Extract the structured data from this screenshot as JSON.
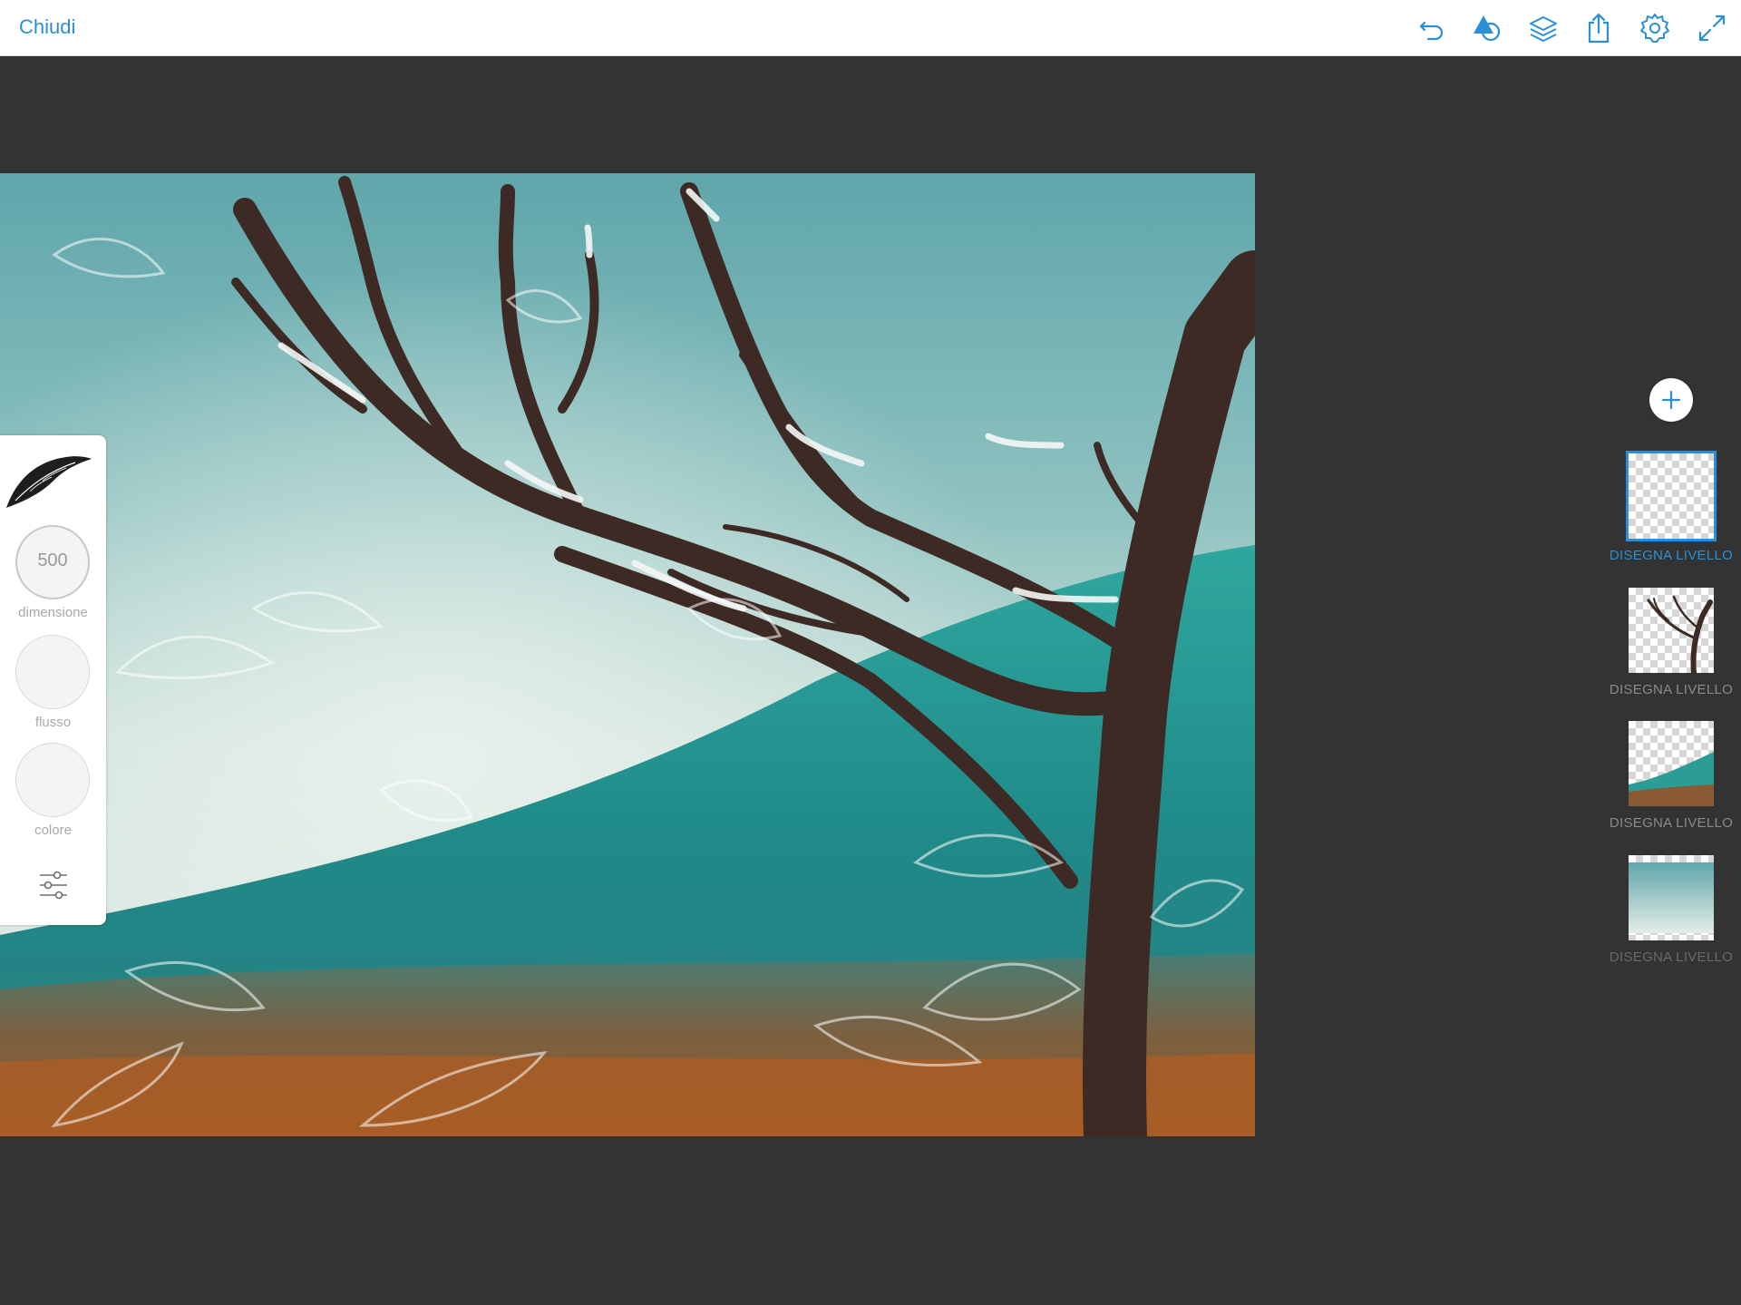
{
  "topbar": {
    "close_label": "Chiudi",
    "icons": [
      "undo-icon",
      "shape-icon",
      "layers-icon",
      "share-icon",
      "settings-icon",
      "fullscreen-icon"
    ],
    "accent_color": "#2a8fd4"
  },
  "brush_panel": {
    "size_value": "500",
    "size_label": "dimensione",
    "flow_label": "flusso",
    "color_label": "colore"
  },
  "layers": {
    "add_icon": "plus-icon",
    "items": [
      {
        "label": "DISEGNA LIVELLO",
        "selected": true
      },
      {
        "label": "DISEGNA LIVELLO",
        "selected": false
      },
      {
        "label": "DISEGNA LIVELLO",
        "selected": false
      },
      {
        "label": "DISEGNA LIVELLO",
        "selected": false
      }
    ]
  }
}
